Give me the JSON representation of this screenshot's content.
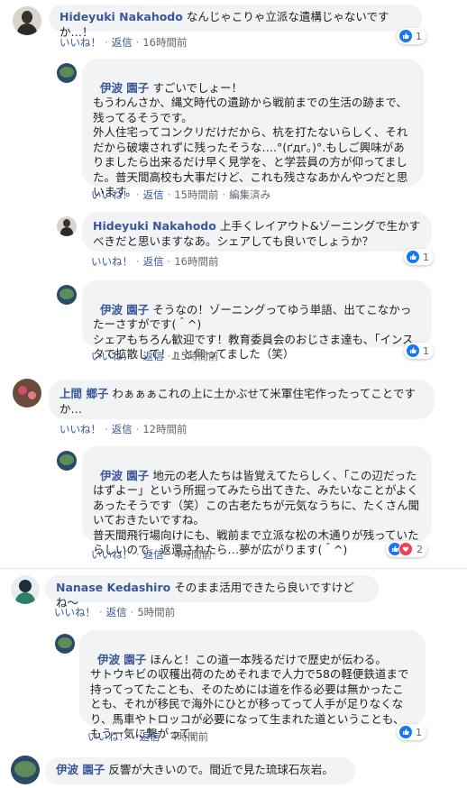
{
  "actions": {
    "like": "いいね！",
    "reply": "返信",
    "edited": "編集済み"
  },
  "comments": [
    {
      "author": "Hideyuki Nakahodo",
      "text": "なんじゃこりゃ立派な遺構じゃないですか…！",
      "time": "16時間前",
      "reactions": "1"
    },
    {
      "author": "伊波 園子",
      "text": "すごいでしょー！\nもうわんさか、縄文時代の遺跡から戦前までの生活の跡まで、残ってるそうです。\n外人住宅ってコンクリだけだから、杭を打たないらしく、それだから破壊されずに残ったそうな….°(ґдґ｡)°.もしご興味がありましたら出来るだけ早く見学を、と学芸員の方が仰ってました。普天間高校も大事だけど、これも残さなあかんやつだと思います。",
      "time": "15時間前"
    },
    {
      "author": "Hideyuki Nakahodo",
      "text": "上手くレイアウト&ゾーニングで生かすべきだと思いますなあ。シェアしても良いでしょうか？",
      "time": "16時間前",
      "reactions": "1"
    },
    {
      "author": "伊波 園子",
      "text": "そうなの！ゾーニングってゆう単語、出てこなかったーさすがです(＾^)\nシェアもちろん歓迎です！教育委員会のおじさま達も、「インスタで拡散して！」と仰ってました（笑）",
      "time": "15時間前",
      "reactions": "1"
    },
    {
      "author": "上間 郷子",
      "text": "わぁぁぁこれの上に土かぶせて米軍住宅作ったってことですか…",
      "time": "12時間前"
    },
    {
      "author": "伊波 園子",
      "text": "地元の老人たちは皆覚えてたらしく、「この辺だったはずよー」という所掘ってみたら出てきた、みたいなことがよくあったそうです（笑）この古老たちが元気なうちに、たくさん聞いておきたいですね。\n普天間飛行場向けにも、戦前まで立派な松の木通りが残っていたらしいので、返還されたら…夢が広がります(＾^)",
      "time": "4時間前",
      "reactions": "2"
    },
    {
      "author": "Nanase Kedashiro",
      "text": "そのまま活用できたら良いですけどね〜",
      "time": "5時間前"
    },
    {
      "author": "伊波 園子",
      "text": "ほんと！この道一本残るだけで歴史が伝わる。\nサトウキビの収穫出荷のためそれまで人力で58の軽便鉄道まで持ってってたことも、そのためには道を作る必要は無かったことも、それが移民で海外にひとが移ってって人手が足りなくなり、馬車やトロッコが必要になって生まれた道ということも、もう一気に繋がって。",
      "time": "4時間前",
      "reactions": "1"
    },
    {
      "author": "伊波 園子",
      "text": "反響が大きいので。間近で見た琉球石灰岩。"
    }
  ],
  "colors": {
    "link": "#385898",
    "bubble": "#f2f3f5",
    "like": "#1877f2",
    "love": "#f33e58"
  }
}
